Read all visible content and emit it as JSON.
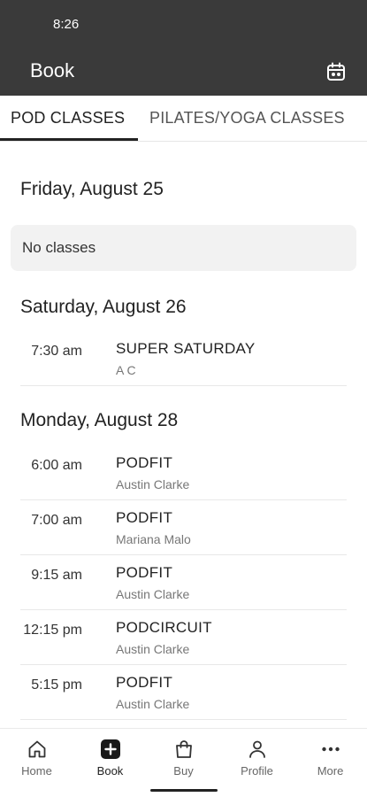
{
  "status_bar": {
    "time": "8:26"
  },
  "header": {
    "title": "Book",
    "calendar_icon": "calendar-icon"
  },
  "tabs": [
    {
      "label": "POD CLASSES",
      "active": true
    },
    {
      "label": "PILATES/YOGA CLASSES",
      "active": false
    }
  ],
  "days": [
    {
      "heading": "Friday, August 25",
      "empty_text": "No classes",
      "classes": []
    },
    {
      "heading": "Saturday, August 26",
      "classes": [
        {
          "time": "7:30 am",
          "name": "SUPER SATURDAY",
          "instructor": "A C"
        }
      ]
    },
    {
      "heading": "Monday, August 28",
      "classes": [
        {
          "time": "6:00 am",
          "name": "PODFIT",
          "instructor": "Austin Clarke"
        },
        {
          "time": "7:00 am",
          "name": "PODFIT",
          "instructor": "Mariana Malo"
        },
        {
          "time": "9:15 am",
          "name": "PODFIT",
          "instructor": "Austin Clarke"
        },
        {
          "time": "12:15 pm",
          "name": "PODCIRCUIT",
          "instructor": "Austin Clarke"
        },
        {
          "time": "5:15 pm",
          "name": "PODFIT",
          "instructor": "Austin Clarke"
        }
      ]
    }
  ],
  "bottom_nav": [
    {
      "label": "Home",
      "icon": "home-icon"
    },
    {
      "label": "Book",
      "icon": "plus-square-icon",
      "active": true
    },
    {
      "label": "Buy",
      "icon": "shopping-bag-icon"
    },
    {
      "label": "Profile",
      "icon": "person-icon"
    },
    {
      "label": "More",
      "icon": "more-dots-icon"
    }
  ],
  "colors": {
    "app_bar": "#3a3a3a",
    "accent": "#222222",
    "empty_box": "#f2f2f2"
  }
}
